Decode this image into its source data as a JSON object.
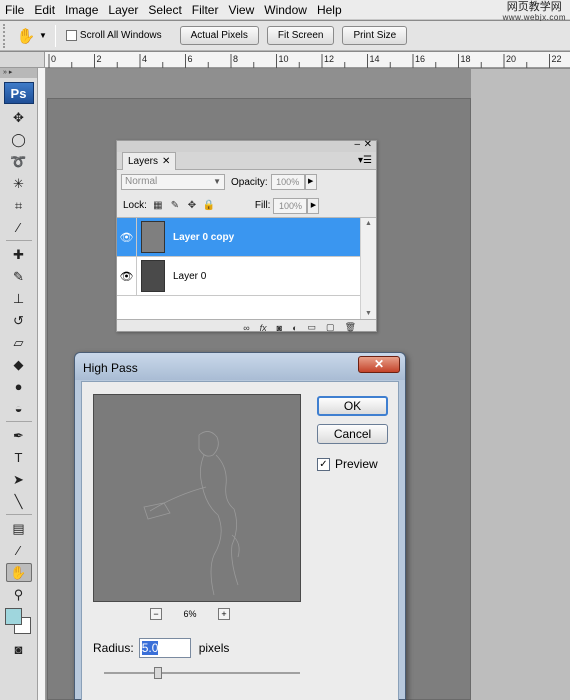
{
  "menu": [
    "File",
    "Edit",
    "Image",
    "Layer",
    "Select",
    "Filter",
    "View",
    "Window",
    "Help"
  ],
  "watermark": {
    "line1": "网页教学网",
    "line2": "www.webjx.com"
  },
  "options": {
    "scroll_all": "Scroll All Windows",
    "actual_pixels": "Actual Pixels",
    "fit_screen": "Fit Screen",
    "print_size": "Print Size"
  },
  "ruler": [
    "0",
    "2",
    "4",
    "6",
    "8",
    "10",
    "12",
    "14",
    "16",
    "18",
    "20",
    "22"
  ],
  "toolbox": {
    "logo": "Ps"
  },
  "layers": {
    "tab": "Layers",
    "blend_mode": "Normal",
    "opacity_label": "Opacity:",
    "opacity_value": "100%",
    "lock_label": "Lock:",
    "fill_label": "Fill:",
    "fill_value": "100%",
    "items": [
      {
        "name": "Layer 0 copy",
        "selected": true
      },
      {
        "name": "Layer 0",
        "selected": false
      }
    ]
  },
  "dialog": {
    "title": "High Pass",
    "ok": "OK",
    "cancel": "Cancel",
    "preview_label": "Preview",
    "preview_checked": true,
    "zoom": "6%",
    "radius_label": "Radius:",
    "radius_value": "5.0",
    "radius_unit": "pixels"
  }
}
